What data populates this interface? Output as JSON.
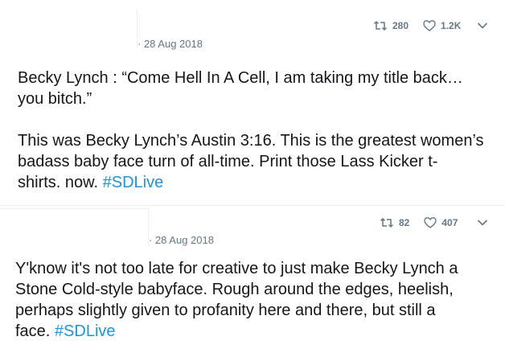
{
  "tweets": [
    {
      "date": "· 28 Aug 2018",
      "retweets": "280",
      "likes": "1.2K",
      "paragraph1": "Becky Lynch : “Come Hell In A Cell, I am taking my title back…\nyou bitch.”",
      "paragraph2": "This was Becky Lynch’s Austin 3:16. This is the greatest women’s\nbadass baby face turn of all-time. Print those Lass Kicker t-\nshirts. now. ",
      "hashtag": "#SDLive"
    },
    {
      "date": "· 28 Aug 2018",
      "retweets": "82",
      "likes": "407",
      "paragraph1": "Y'know it's not too late for creative to just make Becky Lynch a\nStone Cold-style babyface.  Rough around the edges, heelish,\nperhaps slightly given to profanity here and there, but still a\nface. ",
      "hashtag": "#SDLive"
    }
  ],
  "icons": {
    "retweet": "retweet-icon",
    "like": "heart-icon",
    "more": "chevron-down-icon"
  },
  "colors": {
    "text": "#14171a",
    "muted": "#657786",
    "hashtag": "#1b95e0"
  }
}
